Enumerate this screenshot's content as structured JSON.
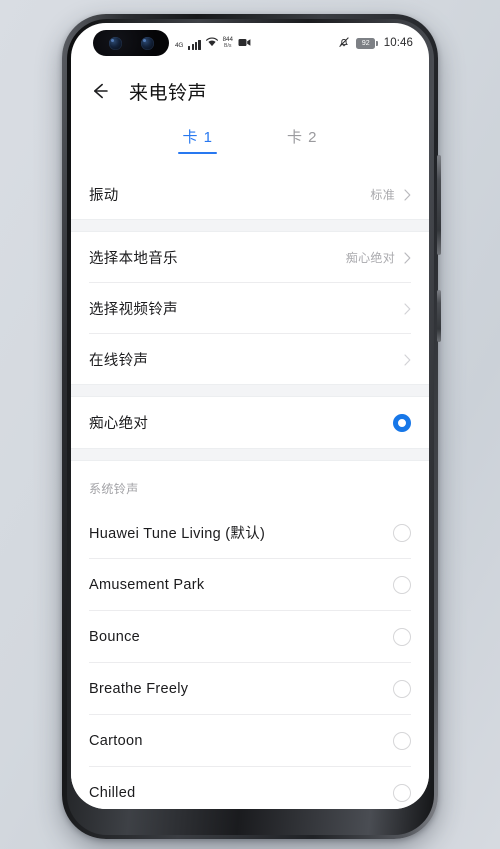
{
  "status_bar": {
    "network_type": "4G",
    "data_rate_value": "844",
    "data_rate_unit": "B/s",
    "battery_percent": "92",
    "time": "10:46",
    "icons": [
      "signal-bars-icon",
      "wifi-icon",
      "data-rate-indicator",
      "video-recording-icon",
      "silent-mode-icon",
      "battery-icon"
    ]
  },
  "appbar": {
    "back_icon": "back-arrow-icon",
    "title": "来电铃声"
  },
  "tabs": [
    {
      "label": "卡 1",
      "active": true
    },
    {
      "label": "卡 2",
      "active": false
    }
  ],
  "vibration": {
    "label": "振动",
    "value": "标准"
  },
  "sources": [
    {
      "label": "选择本地音乐",
      "value": "痴心绝对"
    },
    {
      "label": "选择视频铃声",
      "value": ""
    },
    {
      "label": "在线铃声",
      "value": ""
    }
  ],
  "current_selection": {
    "label": "痴心绝对",
    "selected": true
  },
  "system_section": {
    "header": "系统铃声",
    "items": [
      {
        "label": "Huawei Tune Living (默认)",
        "selected": false
      },
      {
        "label": "Amusement Park",
        "selected": false
      },
      {
        "label": "Bounce",
        "selected": false
      },
      {
        "label": "Breathe Freely",
        "selected": false
      },
      {
        "label": "Cartoon",
        "selected": false
      },
      {
        "label": "Chilled",
        "selected": false
      }
    ]
  },
  "colors": {
    "accent": "#2878f0",
    "radio_selected": "#1777e8",
    "text_primary": "#1b1b1d",
    "text_secondary": "#a9a9ad",
    "divider": "#ececee",
    "section_band": "#f3f4f6",
    "page_background": "#d5dae0"
  }
}
